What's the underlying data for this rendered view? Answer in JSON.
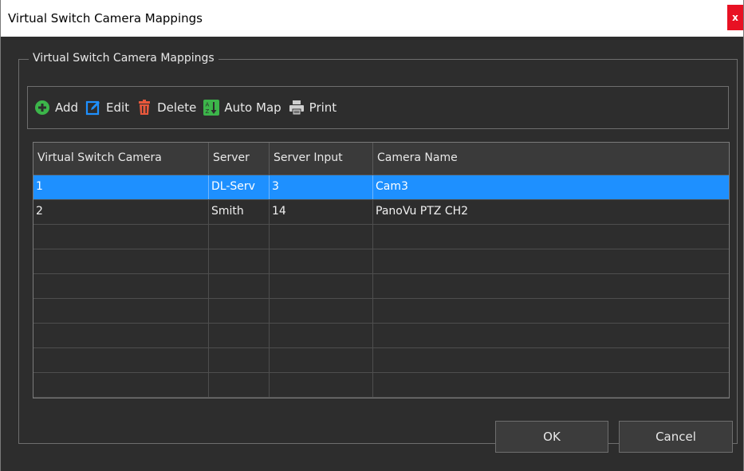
{
  "window": {
    "title": "Virtual Switch Camera Mappings",
    "close_label": "x"
  },
  "groupbox": {
    "title": "Virtual Switch Camera Mappings"
  },
  "toolbar": {
    "items": [
      {
        "label": "Add",
        "icon": "add-icon",
        "color": "#3cb54a"
      },
      {
        "label": "Edit",
        "icon": "edit-icon",
        "color": "#1e90ff"
      },
      {
        "label": "Delete",
        "icon": "delete-icon",
        "color": "#e8583c"
      },
      {
        "label": "Auto Map",
        "icon": "auto-map-icon",
        "color": "#3cb54a"
      },
      {
        "label": "Print",
        "icon": "print-icon",
        "color": "#cfcfcf"
      }
    ]
  },
  "table": {
    "columns": [
      "Virtual Switch Camera",
      "Server",
      "Server Input",
      "Camera Name"
    ],
    "rows": [
      [
        "1",
        "DL-Serv",
        "3",
        "Cam3"
      ],
      [
        "2",
        "Smith",
        "14",
        "PanoVu PTZ CH2"
      ],
      [
        "",
        "",
        "",
        ""
      ],
      [
        "",
        "",
        "",
        ""
      ],
      [
        "",
        "",
        "",
        ""
      ],
      [
        "",
        "",
        "",
        ""
      ],
      [
        "",
        "",
        "",
        ""
      ],
      [
        "",
        "",
        "",
        ""
      ],
      [
        "",
        "",
        "",
        ""
      ]
    ],
    "selected_row": 0
  },
  "buttons": {
    "ok": "OK",
    "cancel": "Cancel"
  },
  "colors": {
    "selection": "#1e90ff",
    "background": "#2d2d2d",
    "close": "#e81123"
  }
}
